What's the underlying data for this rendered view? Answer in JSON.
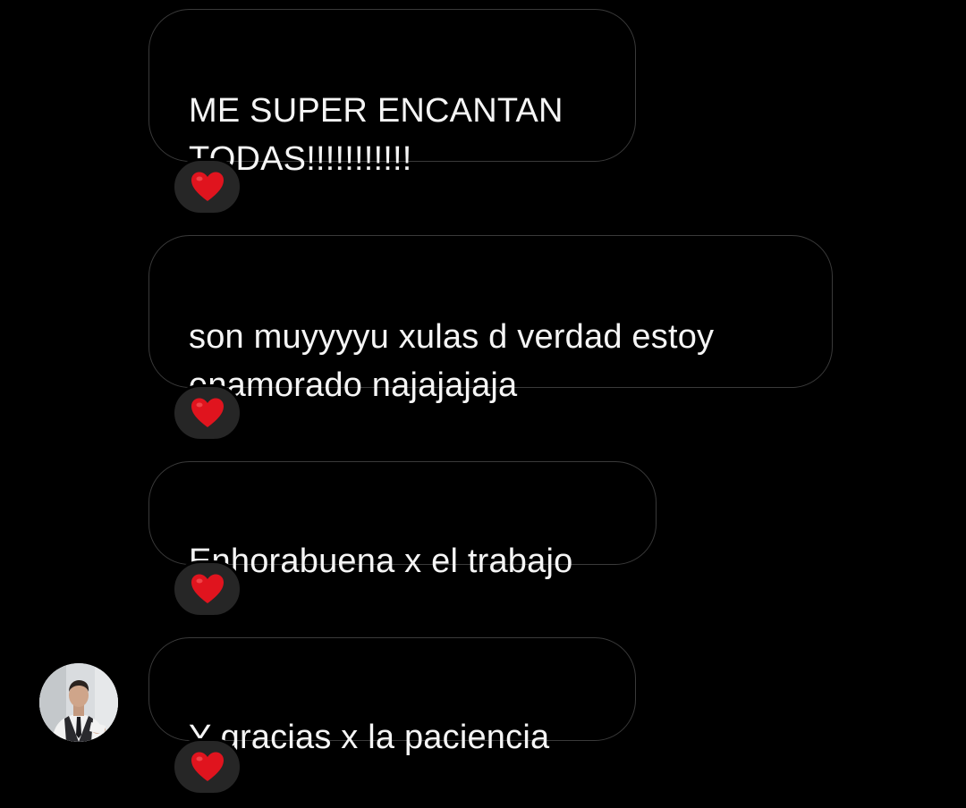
{
  "messages": [
    {
      "text": "ME SUPER ENCANTAN\nTODAS!!!!!!!!!!!",
      "reaction": "red-heart-icon"
    },
    {
      "text": "son muyyyyu xulas d verdad estoy\nenamorado najajajaja",
      "reaction": "red-heart-icon"
    },
    {
      "text": "Enhorabuena x el trabajo",
      "reaction": "red-heart-icon"
    },
    {
      "text": "Y gracias x la paciencia",
      "reaction": "red-heart-icon"
    }
  ],
  "colors": {
    "background": "#000000",
    "bubble_border": "#3a3a3a",
    "text": "#f5f5f5",
    "reaction_pill": "#262626",
    "heart": "#e0141e"
  },
  "avatar": {
    "icon": "profile-photo"
  }
}
